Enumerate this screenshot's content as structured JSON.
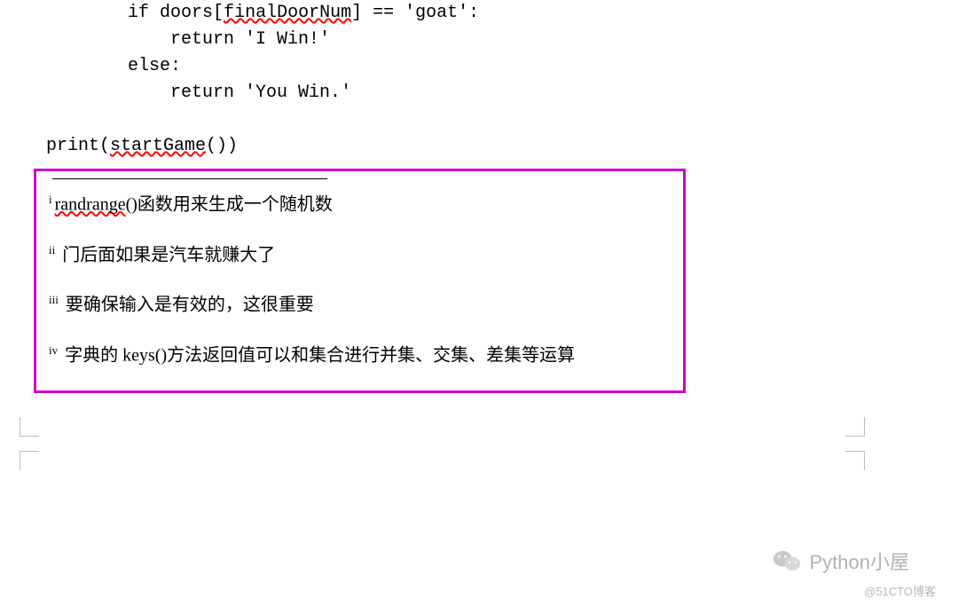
{
  "code": {
    "line1_indent": "            ",
    "line1_if": "if doors[",
    "line1_var": "finalDoorNum",
    "line1_rest": "] == 'goat':",
    "line2": "                return 'I Win!'",
    "line3": "            else:",
    "line4": "                return 'You Win.'",
    "line5": "",
    "line6_a": "print(",
    "line6_fn": "startGame",
    "line6_b": "())"
  },
  "footnotes": {
    "n1_sup": "i",
    "n1_fn": "randrange",
    "n1_text": "()函数用来生成一个随机数",
    "n2_sup": "ii",
    "n2_text": " 门后面如果是汽车就赚大了",
    "n3_sup": "iii",
    "n3_text": " 要确保输入是有效的，这很重要",
    "n4_sup": "iv",
    "n4_text": " 字典的 keys()方法返回值可以和集合进行并集、交集、差集等运算"
  },
  "watermark": {
    "wechat": "Python小屋",
    "cto": "@51CTO博客"
  }
}
